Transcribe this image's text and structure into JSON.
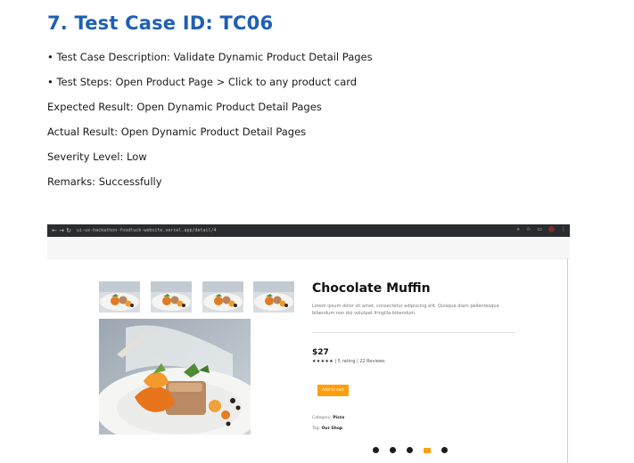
{
  "heading": "7. Test Case ID: TC06",
  "lines": [
    "• Test Case Description: Validate Dynamic Product Detail Pages",
    "• Test Steps: Open Product Page > Click to any product card",
    "Expected Result: Open Dynamic Product Detail Pages",
    "Actual Result: Open Dynamic Product Detail Pages",
    "Severity Level: Low",
    "Remarks: Successfully"
  ],
  "screenshot": {
    "browser": {
      "nav": "←  →  ↻",
      "url": "ui-ux-hackathon-foodtuck-website.vercel.app/detail/4",
      "icons": [
        "search-icon",
        "star-icon",
        "extensions-icon",
        "profile-icon",
        "menu-icon"
      ]
    },
    "product": {
      "title": "Chocolate Muffin",
      "description": "Lorem ipsum dolor sit amet, consectetur adipiscing elit. Quisque diam pellentesque bibendum non dui volutpat fringilla bibendum.",
      "price": "$27",
      "stars": "★★★★★",
      "rating_text": "| 5 rating | 22 Reviews",
      "add_to_cart": "Add to cart",
      "category_label": "Category:",
      "category_value": "Pizza",
      "tag_label": "Tag:",
      "tag_value": "Our Shop"
    },
    "social_icons": [
      "facebook-icon",
      "twitter-icon",
      "instagram-icon",
      "youtube-icon",
      "pinterest-icon"
    ],
    "colors": {
      "accent": "#ff9f0d",
      "heading_blue": "#1f5fb4",
      "browser_bar": "#2b2c2f"
    }
  }
}
